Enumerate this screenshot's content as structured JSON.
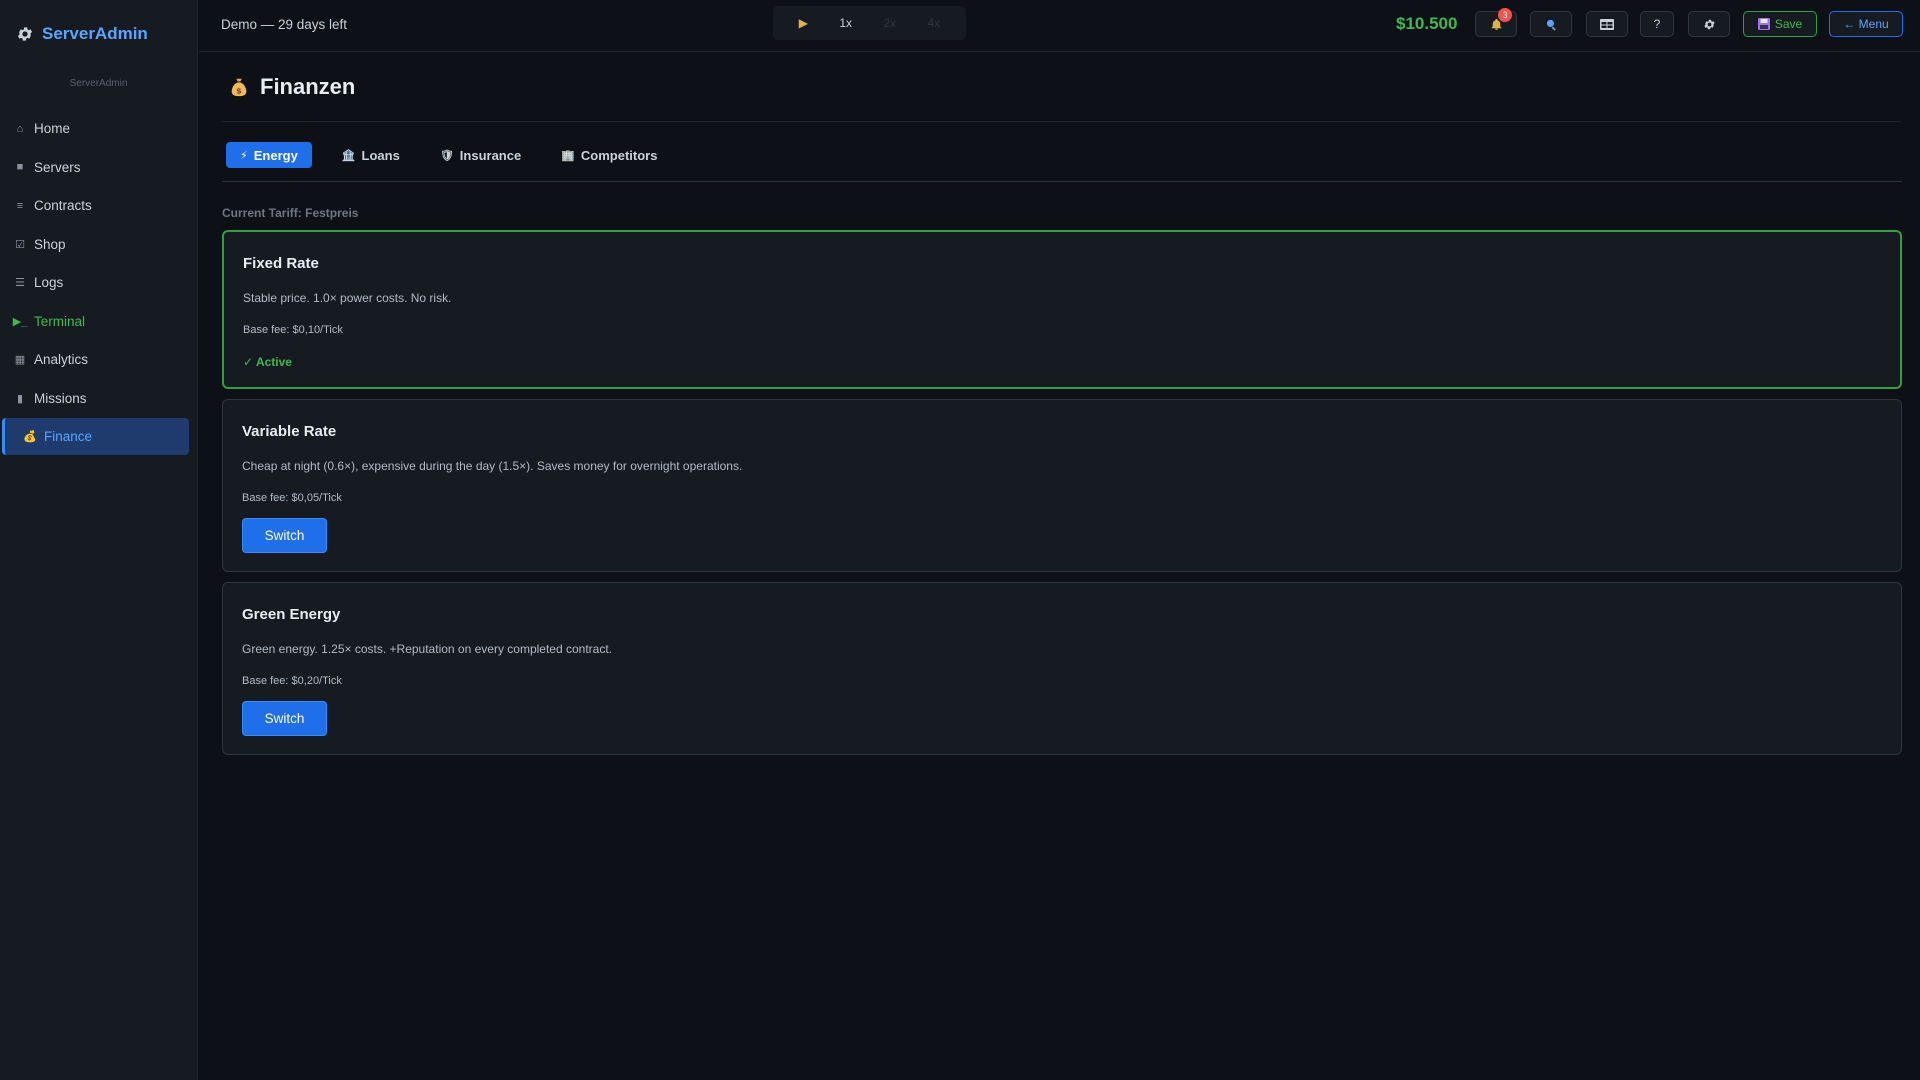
{
  "app": {
    "title": "ServerAdmin",
    "subtitle": "ServerAdmin"
  },
  "sidebar": {
    "items": [
      {
        "label": "Home",
        "icon": "home-icon",
        "glyph": "⌂"
      },
      {
        "label": "Servers",
        "icon": "server-icon",
        "glyph": "■"
      },
      {
        "label": "Contracts",
        "icon": "contracts-icon",
        "glyph": "≡"
      },
      {
        "label": "Shop",
        "icon": "shop-icon",
        "glyph": "☑"
      },
      {
        "label": "Logs",
        "icon": "logs-icon",
        "glyph": "☰"
      },
      {
        "label": "Terminal",
        "icon": "terminal-icon",
        "glyph": "▶_"
      },
      {
        "label": "Analytics",
        "icon": "analytics-icon",
        "glyph": "▦"
      },
      {
        "label": "Missions",
        "icon": "missions-icon",
        "glyph": "▮"
      },
      {
        "label": "Finance",
        "icon": "money-bag-icon",
        "glyph": "💰"
      }
    ],
    "active": "Finance"
  },
  "topbar": {
    "demo_text": "Demo — 29 days left",
    "speed": {
      "play": "▶",
      "s1": "1x",
      "s2": "2x",
      "s3": "4x"
    },
    "money": "$10.500",
    "notifications_count": "3",
    "save_label": "Save",
    "menu_label": "← Menu"
  },
  "page": {
    "title": "Finanzen",
    "tabs": [
      {
        "label": "Energy",
        "icon": "lightning-icon",
        "glyph": "⚡"
      },
      {
        "label": "Loans",
        "icon": "bank-icon",
        "glyph": "🏦"
      },
      {
        "label": "Insurance",
        "icon": "shield-icon",
        "glyph": "🛡"
      },
      {
        "label": "Competitors",
        "icon": "building-icon",
        "glyph": "🏢"
      }
    ],
    "current_tariff": "Current Tariff: Festpreis",
    "tariffs": [
      {
        "name": "Fixed Rate",
        "description": "Stable price. 1.0× power costs. No risk.",
        "fee": "Base fee: $0,10/Tick",
        "status": "✓ Active"
      },
      {
        "name": "Variable Rate",
        "description": "Cheap at night (0.6×), expensive during the day (1.5×). Saves money for overnight operations.",
        "fee": "Base fee: $0,05/Tick",
        "button": "Switch"
      },
      {
        "name": "Green Energy",
        "description": "Green energy. 1.25× costs. +Reputation on every completed contract.",
        "fee": "Base fee: $0,20/Tick",
        "button": "Switch"
      }
    ]
  },
  "colors": {
    "accent": "#1f6feb",
    "success": "#3fb950",
    "money": "#3fb950",
    "danger": "#f85149",
    "background": "#0d1117"
  }
}
